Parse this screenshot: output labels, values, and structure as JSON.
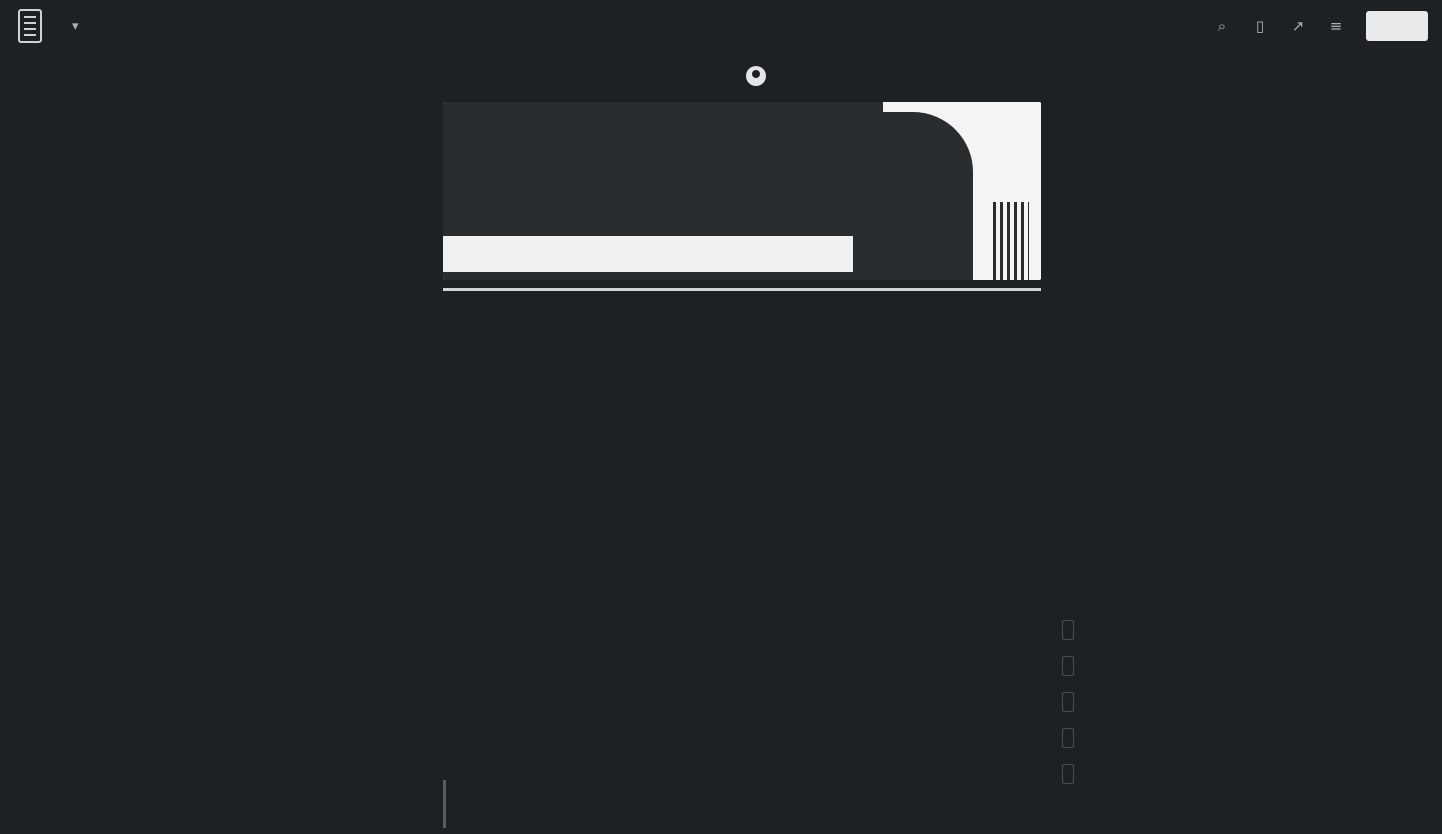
{
  "topbar": {
    "site_title": "",
    "chevron": "▾",
    "icons": [
      "search-icon",
      "bookmark-icon",
      "share-icon",
      "menu-icon"
    ],
    "action_button": ""
  },
  "byline": {
    "author": "",
    "date": "",
    "read_time": ""
  },
  "hero": {
    "title": "",
    "subtitle": "",
    "strip_left": "",
    "strip_mid": "",
    "strip_right": ""
  },
  "post": {
    "title": "",
    "meta": "",
    "paragraphs": [
      "",
      ""
    ],
    "list": [
      "",
      "",
      "",
      "",
      ""
    ]
  },
  "footer": {
    "left": "",
    "right": ""
  },
  "colors": {
    "background": "#1e2124",
    "text": "#d8d9da",
    "hero_light": "#f1f1f1",
    "hero_dark": "#2a2d30"
  }
}
